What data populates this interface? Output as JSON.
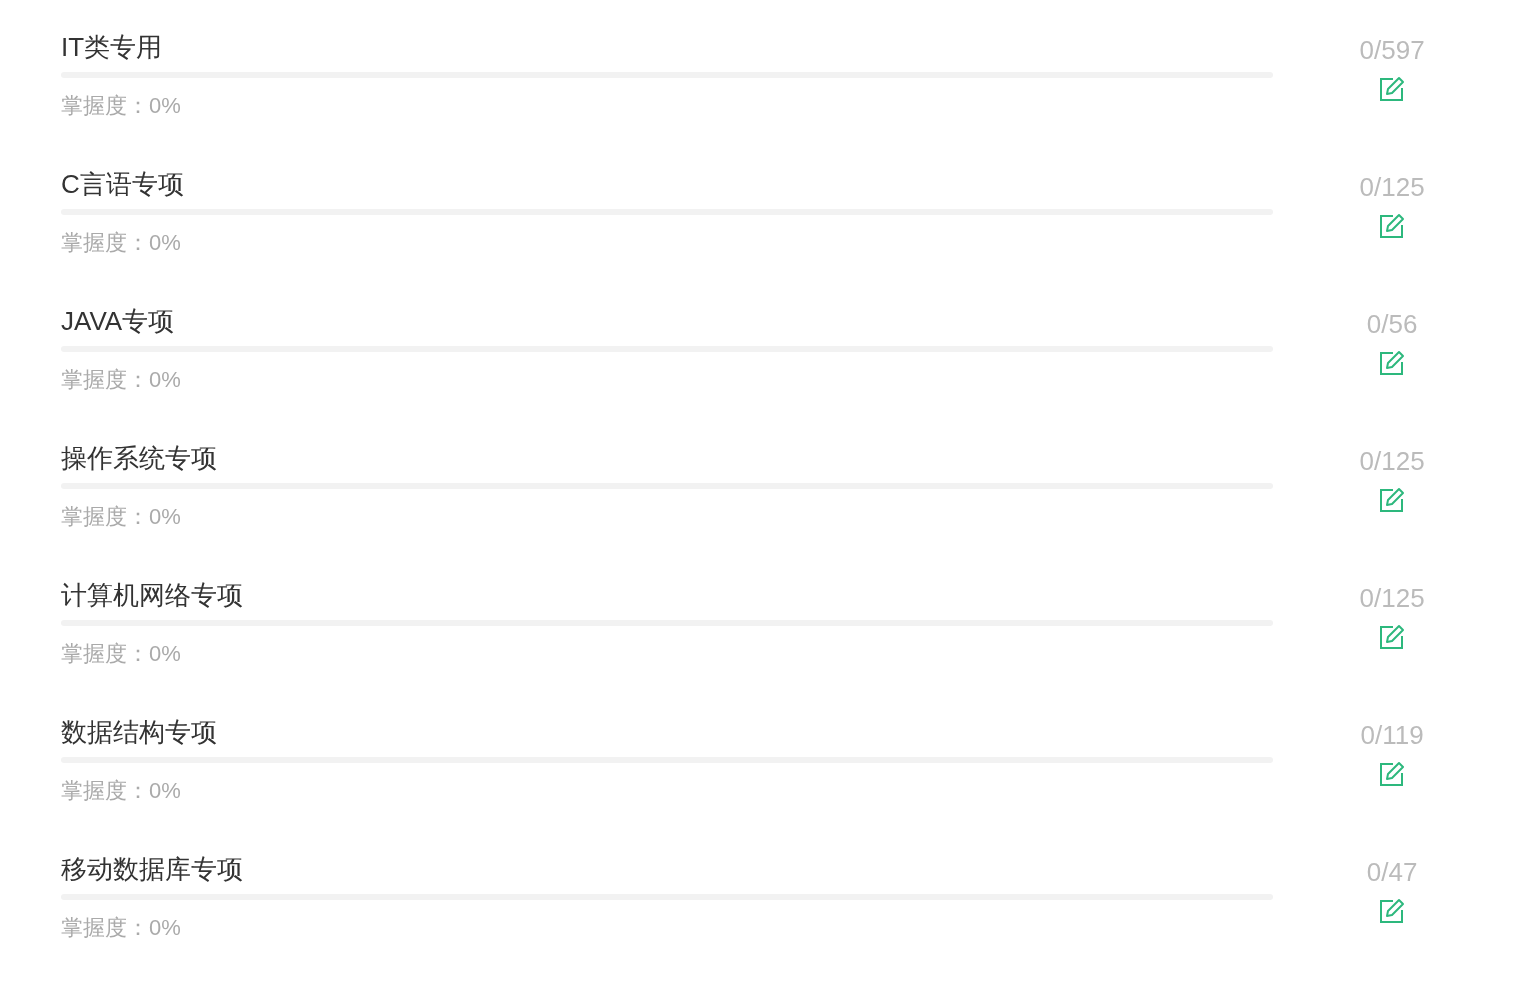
{
  "topics": [
    {
      "title": "IT类专用",
      "mastery": "掌握度：0%",
      "level": 0,
      "count": "0/597"
    },
    {
      "title": "C言语专项",
      "mastery": "掌握度：0%",
      "level": 0,
      "count": "0/125"
    },
    {
      "title": "JAVA专项",
      "mastery": "掌握度：0%",
      "level": 0,
      "count": "0/56"
    },
    {
      "title": "操作系统专项",
      "mastery": "掌握度：0%",
      "level": 0,
      "count": "0/125"
    },
    {
      "title": "计算机网络专项",
      "mastery": "掌握度：0%",
      "level": 0,
      "count": "0/125"
    },
    {
      "title": "数据结构专项",
      "mastery": "掌握度：0%",
      "level": 0,
      "count": "0/119"
    },
    {
      "title": "移动数据库专项",
      "mastery": "掌握度：0%",
      "level": 0,
      "count": "0/47"
    }
  ]
}
